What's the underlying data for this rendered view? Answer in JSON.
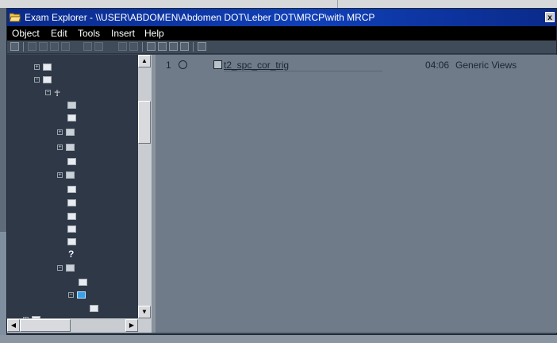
{
  "window": {
    "title": "Exam Explorer - \\\\USER\\ABDOMEN\\Abdomen DOT\\Leber DOT\\MRCP\\with MRCP",
    "close_glyph": "x"
  },
  "menu": {
    "items": [
      {
        "label": "Object"
      },
      {
        "label": "Edit"
      },
      {
        "label": "Tools"
      },
      {
        "label": "Insert"
      },
      {
        "label": "Help"
      }
    ]
  },
  "tree": {
    "question_mark": "?",
    "expand_minus": "−",
    "expand_plus": "+"
  },
  "list": {
    "rows": [
      {
        "number": "1",
        "name": "t2_spc_cor_trig",
        "time": "04:06",
        "views": "Generic Views"
      }
    ]
  },
  "scroll": {
    "up": "▲",
    "down": "▼",
    "left": "◀",
    "right": "▶"
  }
}
